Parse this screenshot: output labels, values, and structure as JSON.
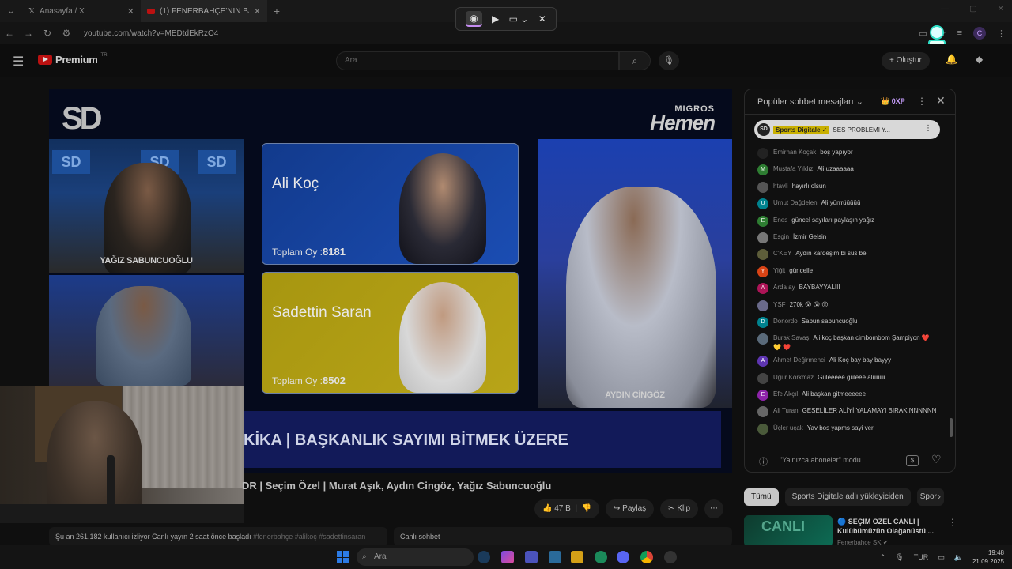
{
  "browser": {
    "tabs": [
      {
        "title": "Anasayfa / X"
      },
      {
        "title": "(1) FENERBAHÇE'NİN BAŞKANI"
      }
    ],
    "url": "youtube.com/watch?v=MEDtdEkRzO4"
  },
  "yt_header": {
    "brand": "Premium",
    "country": "TR",
    "search_placeholder": "Ara",
    "create_label": "Oluştur"
  },
  "video": {
    "logo": "SD",
    "sponsor_top": "MIGROS",
    "sponsor_main": "Hemen",
    "candidates": [
      {
        "name": "Ali Koç",
        "votes_label": "Toplam Oy :",
        "votes": "8181"
      },
      {
        "name": "Sadettin Saran",
        "votes_label": "Toplam Oy :",
        "votes": "8502"
      }
    ],
    "cam_labels": {
      "top_left": "YAĞIZ SABUNCUOĞLU",
      "right": "AYDIN CİNGÖZ"
    },
    "ticker": "KİKA | BAŞKANLIK SAYIMI BİTMEK ÜZERE",
    "title": "DR | Seçim Özel | Murat Aşık, Aydın Cingöz, Yağız Sabuncuoğlu"
  },
  "actions": {
    "likes": "47 B",
    "share": "Paylaş",
    "clip": "Klip"
  },
  "description_bar": {
    "text": "Şu an 261.182 kullanıcı izliyor  Canlı yayın 2 saat önce başladı",
    "hashtags": "#fenerbahçe #alikoç #sadettinsaran"
  },
  "livechat_label": "Canlı sohbet",
  "chat": {
    "header": "Popüler sohbet mesajları",
    "xp": "0XP",
    "pinned": {
      "author": "Sports Digitale",
      "text": "SES PROBLEMI Y..."
    },
    "messages": [
      {
        "name": "Emirhan Koçak",
        "text": "boş yapıyor",
        "initial": "",
        "color": "#222222"
      },
      {
        "name": "Mustafa Yıldız",
        "text": "Ali uzaaaaaa",
        "initial": "M",
        "color": "#2e7d32"
      },
      {
        "name": "htavli",
        "text": "hayırlı olsun",
        "initial": "",
        "color": "#555555"
      },
      {
        "name": "Umut Dağdelen",
        "text": "Ali yürrrüüüüü",
        "initial": "U",
        "color": "#00838f"
      },
      {
        "name": "Enes",
        "text": "güncel sayıları paylaşın yağız",
        "initial": "E",
        "color": "#2e7d32"
      },
      {
        "name": "Esgin",
        "text": "İzmir Gelsin",
        "initial": "",
        "color": "#777777"
      },
      {
        "name": "C'KEY",
        "text": "Aydın kardeşim bi sus be",
        "initial": "",
        "color": "#5d5d3a"
      },
      {
        "name": "Yiğit",
        "text": "güncelle",
        "initial": "Y",
        "color": "#d84315"
      },
      {
        "name": "Arda ay",
        "text": "BAYBAYYALİİİ",
        "initial": "A",
        "color": "#ad1457"
      },
      {
        "name": "YSF",
        "text": "270k 😮 😮 😮",
        "initial": "",
        "color": "#6a6a8a"
      },
      {
        "name": "Donordo",
        "text": "Sabun sabuncuoğlu",
        "initial": "D",
        "color": "#00838f"
      },
      {
        "name": "Burak Savaş",
        "text": "Ali koç başkan cimbombom Şampiyon ❤️ 💛 ❤️",
        "initial": "",
        "color": "#5a6a7a"
      },
      {
        "name": "Ahmet Değirmenci",
        "text": "Ali Koç bay bay bayyy",
        "initial": "A",
        "color": "#5e35b1"
      },
      {
        "name": "Uğur Korkmaz",
        "text": "Güleeeee güleee aliiiiiiiii",
        "initial": "",
        "color": "#444444"
      },
      {
        "name": "Efe Akçıl",
        "text": "Ali başkan gitmeeeeee",
        "initial": "E",
        "color": "#8e24aa"
      },
      {
        "name": "Ali Turan",
        "text": "GESELİLER ALİYİ YALAMAYI BIRAKINNNNNN",
        "initial": "",
        "color": "#666666"
      },
      {
        "name": "Üçler uçak",
        "text": "Yav bos yapms sayi ver",
        "initial": "",
        "color": "#4a5a3a"
      }
    ],
    "footer_mode": "\"Yalnızca aboneler\" modu"
  },
  "recommendations": {
    "chips": [
      "Tümü",
      "Sports Digitale adlı yükleyiciden",
      "Spor"
    ],
    "item": {
      "thumb_text": "CANLI",
      "title": "🔵 SEÇİM ÖZEL CANLI | Kulübümüzün Olağanüstü ...",
      "channel": "Fenerbahçe SK ✔"
    }
  },
  "taskbar": {
    "search": "Ara",
    "lang": "TUR",
    "time": "19:48",
    "date": "21.09.2025"
  }
}
